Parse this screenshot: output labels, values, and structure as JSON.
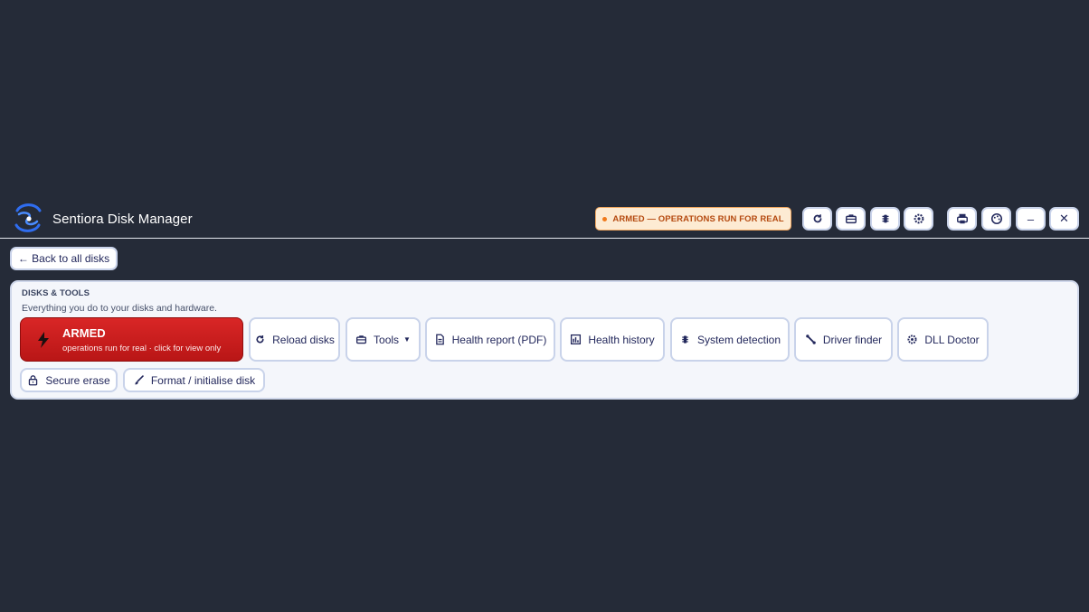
{
  "app": {
    "title": "Sentiora Disk Manager",
    "armed_status": "ARMED — OPERATIONS RUN FOR REAL"
  },
  "titlebar_buttons": [
    {
      "name": "reload-button",
      "icon": "refresh-icon"
    },
    {
      "name": "toolbox-button",
      "icon": "toolbox-icon"
    },
    {
      "name": "detection-button",
      "icon": "chip-icon"
    },
    {
      "name": "dll-button",
      "icon": "cog-icon"
    },
    {
      "name": "print-button",
      "icon": "printer-icon"
    },
    {
      "name": "theme-button",
      "icon": "palette-icon"
    },
    {
      "name": "minimize-button",
      "label": "–"
    },
    {
      "name": "close-button",
      "label": "✕"
    }
  ],
  "nav": {
    "back_label": "← Back to all disks"
  },
  "panel": {
    "eyebrow": "DISKS & TOOLS",
    "subtitle": "Everything you do to your disks and hardware.",
    "armed_card": {
      "title": "ARMED",
      "subtitle": "operations run for real · click for view only"
    },
    "buttons": {
      "reload": "Reload disks",
      "tools": "Tools",
      "health_report": "Health report (PDF)",
      "health_history": "Health history",
      "system_detection": "System detection",
      "driver_finder": "Driver finder",
      "dll_doctor": "DLL Doctor",
      "secure_erase": "Secure erase",
      "format": "Format / initialise disk"
    }
  },
  "colors": {
    "background": "#252b38",
    "armed_red": "#d92626",
    "armed_pill_bg": "#fdebd3",
    "armed_pill_text": "#b54a10",
    "button_text": "#23285c"
  }
}
